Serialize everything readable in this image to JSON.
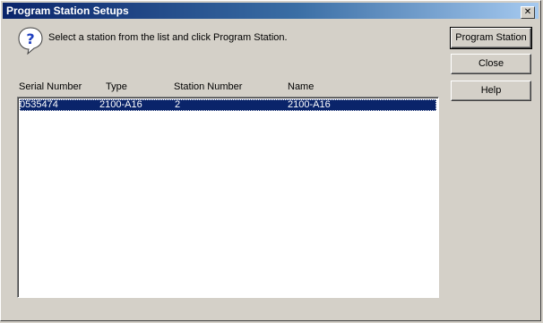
{
  "window": {
    "title": "Program Station Setups",
    "close_glyph": "✕"
  },
  "instruction": "Select a station from the list and click Program Station.",
  "buttons": {
    "program": "Program Station",
    "close": "Close",
    "help": "Help"
  },
  "list": {
    "columns": [
      "Serial Number",
      "Type",
      "Station Number",
      "Name"
    ],
    "rows": [
      {
        "serial": "0535474",
        "type": "2100-A16",
        "station_number": "2",
        "name": "2100-A16",
        "selected": true
      }
    ]
  },
  "icons": {
    "help": "question-mark-balloon-icon",
    "close": "close-icon"
  },
  "colors": {
    "title_start": "#0a246a",
    "title_end": "#a6caf0",
    "selection": "#0a246a",
    "face": "#d4d0c8"
  }
}
